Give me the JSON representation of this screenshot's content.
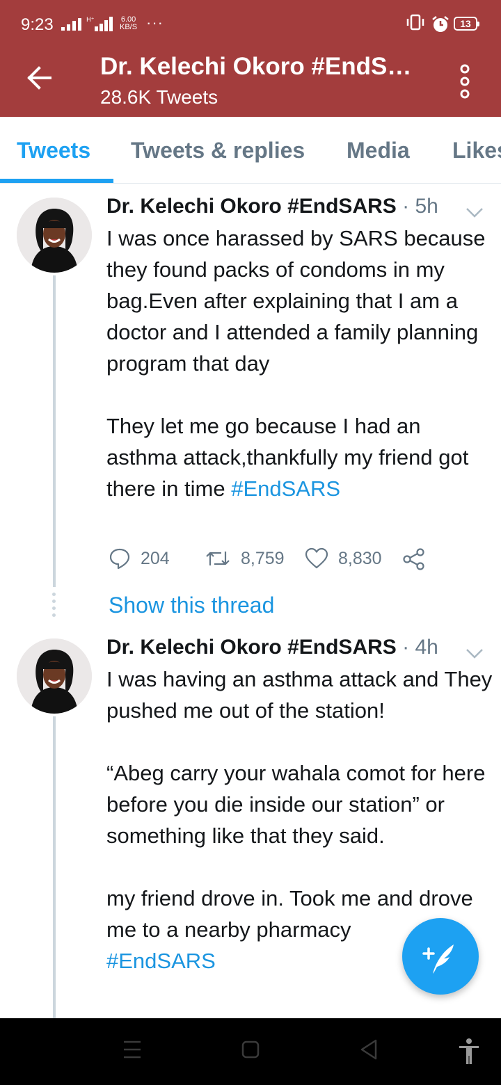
{
  "status_bar": {
    "time": "9:23",
    "net_speed_value": "6.00",
    "net_speed_unit": "KB/S",
    "more_dots": "···",
    "battery": "13",
    "icons": [
      "signal-icon",
      "hplus-signal-icon",
      "vibrate-icon",
      "alarm-icon",
      "battery-icon"
    ]
  },
  "header": {
    "title": "Dr. Kelechi Okoro #EndSARS",
    "subtitle": "28.6K Tweets",
    "back_icon": "back-arrow-icon",
    "more_icon": "more-vertical-icon"
  },
  "tabs": [
    {
      "label": "Tweets",
      "active": true
    },
    {
      "label": "Tweets & replies",
      "active": false
    },
    {
      "label": "Media",
      "active": false
    },
    {
      "label": "Likes",
      "active": false
    }
  ],
  "tweets": [
    {
      "name": "Dr. Kelechi Okoro #EndSARS",
      "separator": "·",
      "time": "5h",
      "body": [
        "I was once harassed by SARS because they found packs of condoms in my bag.Even after explaining that I am a doctor and I attended a family planning program that day",
        "They let me go because I had an asthma attack,thankfully my friend got there in time"
      ],
      "hashtag": "#EndSARS",
      "replies": "204",
      "retweets": "8,759",
      "likes": "8,830",
      "show_thread": "Show this thread"
    },
    {
      "name": "Dr. Kelechi Okoro #EndSARS",
      "separator": "·",
      "time": "4h",
      "body": [
        "I was having an asthma attack and They pushed me out of the station!",
        "“Abeg carry your wahala comot for here before you die inside our station” or something like that they said.",
        "my friend drove in. Took me and drove me to a nearby pharmacy"
      ],
      "hashtag": "#EndSARS"
    }
  ],
  "fab": {
    "icon": "compose-tweet-icon"
  },
  "nav_bar": {
    "icons": [
      "recent-apps-icon",
      "home-icon",
      "back-icon",
      "accessibility-icon"
    ]
  },
  "colors": {
    "header_bg": "#a33d3d",
    "accent": "#1da1f2",
    "link": "#1b95e0",
    "secondary_text": "#657786",
    "thread_line": "#ccd6dd"
  }
}
